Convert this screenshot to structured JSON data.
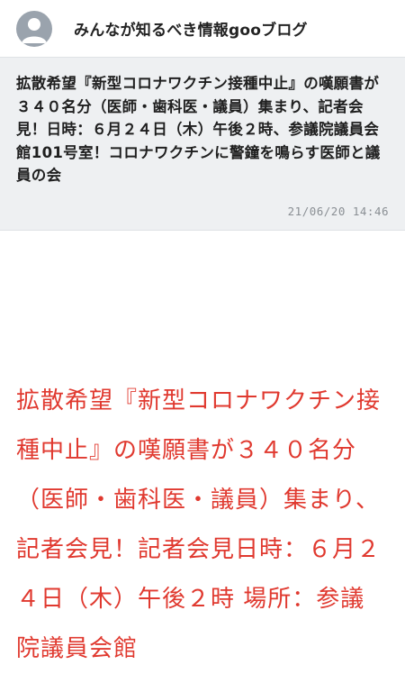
{
  "header": {
    "avatar_icon": "user-avatar-icon",
    "blog_title": "みんなが知るべき情報gooブログ"
  },
  "post": {
    "title": "拡散希望『新型コロナワクチン接種中止』の嘆願書が３４０名分（医師・歯科医・議員）集まり、記者会見！日時：６月２４日（木）午後２時、参議院議員会館101号室！コロナワクチンに警鐘を鳴らす医師と議員の会",
    "date": "21/06/20 14:46"
  },
  "article": {
    "body": "拡散希望『新型コロナワクチン接種中止』の嘆願書が３４０名分（医師・歯科医・議員）集まり、記者会見！記者会見日時：６月２４日（木）午後２時 場所：参議院議員会館"
  },
  "colors": {
    "accent_red": "#e0392f",
    "card_bg": "#eef0f2",
    "avatar_bg": "#9aa3ad"
  }
}
